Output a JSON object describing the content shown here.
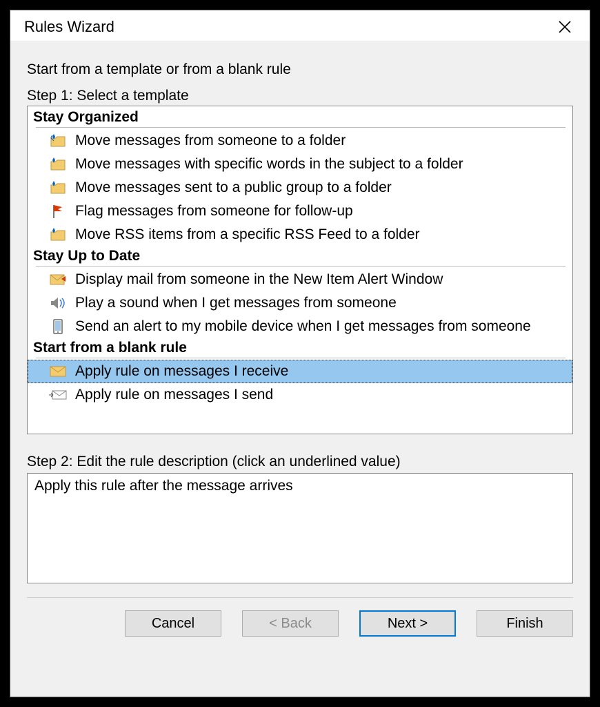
{
  "window": {
    "title": "Rules Wizard"
  },
  "heading": "Start from a template or from a blank rule",
  "step1_label": "Step 1: Select a template",
  "step2_label": "Step 2: Edit the rule description (click an underlined value)",
  "description_text": "Apply this rule after the message arrives",
  "sections": {
    "stay_organized": {
      "title": "Stay Organized",
      "items": [
        "Move messages from someone to a folder",
        "Move messages with specific words in the subject to a folder",
        "Move messages sent to a public group to a folder",
        "Flag messages from someone for follow-up",
        "Move RSS items from a specific RSS Feed to a folder"
      ]
    },
    "stay_up_to_date": {
      "title": "Stay Up to Date",
      "items": [
        "Display mail from someone in the New Item Alert Window",
        "Play a sound when I get messages from someone",
        "Send an alert to my mobile device when I get messages from someone"
      ]
    },
    "blank_rule": {
      "title": "Start from a blank rule",
      "items": [
        "Apply rule on messages I receive",
        "Apply rule on messages I send"
      ],
      "selected_index": 0
    }
  },
  "buttons": {
    "cancel": "Cancel",
    "back": "< Back",
    "next": "Next >",
    "finish": "Finish"
  }
}
